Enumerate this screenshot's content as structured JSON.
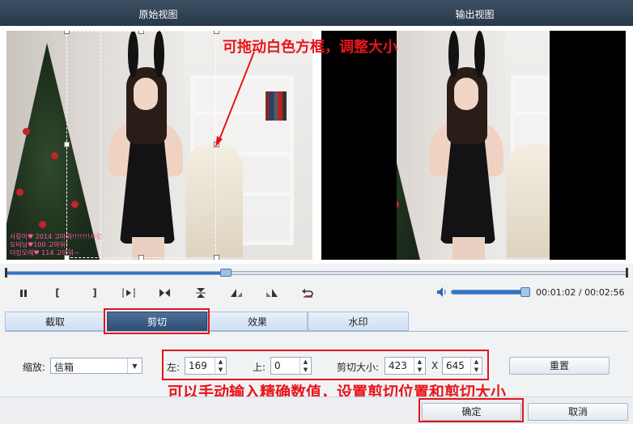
{
  "header": {
    "original_view": "原始视图",
    "output_view": "输出视图"
  },
  "annotations": {
    "drag_hint": "可拖动白色方框，调整大小",
    "input_hint": "可以手动输入精确数值，设置剪切位置和剪切大小"
  },
  "overlay_text": [
    "사랑이♥ 2014 고마워!!!!!!!사랑",
    "모비닝♥100 고마워!",
    "더킹오레♥ 114 고마워~"
  ],
  "playback": {
    "progress": 0.353,
    "current_time": "00:01:02",
    "total_time": "00:02:56",
    "volume": 1.0
  },
  "tabs": [
    {
      "label": "截取",
      "active": false
    },
    {
      "label": "剪切",
      "active": true
    },
    {
      "label": "效果",
      "active": false
    },
    {
      "label": "水印",
      "active": false
    }
  ],
  "crop_settings": {
    "zoom_label": "缩放:",
    "zoom_value": "信箱",
    "left_label": "左:",
    "left_value": "169",
    "top_label": "上:",
    "top_value": "0",
    "size_label": "剪切大小:",
    "width_value": "423",
    "times": "X",
    "height_value": "645",
    "reset_label": "重置"
  },
  "footer": {
    "ok_label": "确定",
    "cancel_label": "取消"
  },
  "colors": {
    "accent": "#2f75c9",
    "annotation_red": "#e8151b",
    "header_bg": "#2f4054"
  }
}
